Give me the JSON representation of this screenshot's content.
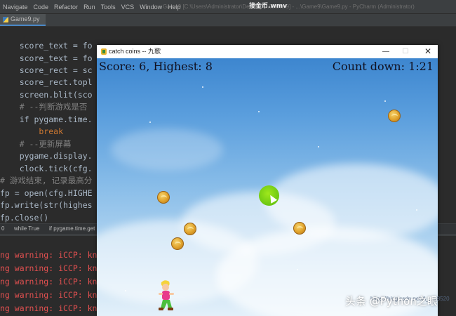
{
  "video_title": "接金币.wmv",
  "ide": {
    "menu": [
      "Navigate",
      "Code",
      "Refactor",
      "Run",
      "Tools",
      "VCS",
      "Window",
      "Help"
    ],
    "title": "Game9 [C:\\Users\\Administrator\\Desktop\\...\\Game9] - ...\\Game9\\Game9.py - PyCharm (Administrator)",
    "file_tab": "Game9.py",
    "code_lines": [
      {
        "code": "    score_text = fo"
      },
      {
        "code": "    score_text = fo"
      },
      {
        "code": "    score_rect = sc"
      },
      {
        "code": "    score_rect.topl"
      },
      {
        "code": "    screen.blit(sco"
      },
      {
        "code": "    # --判断游戏是否"
      },
      {
        "code": "    if pygame.time."
      },
      {
        "code": "        break"
      },
      {
        "code": "    # --更新屏幕"
      },
      {
        "code": "    pygame.display."
      },
      {
        "code": "    clock.tick(cfg."
      },
      {
        "code": "# 游戏结束, 记录最高分"
      },
      {
        "code": "fp = open(cfg.HIGHE"
      },
      {
        "code": "fp.write(str(highes"
      },
      {
        "code": "fp.close()"
      }
    ],
    "breadcrumb": [
      "0",
      "while True",
      "if pygame.time.get"
    ],
    "console_lines": [
      "ng warning: iCCP: kno",
      "ng warning: iCCP: kno",
      "ng warning: iCCP: kno",
      "ng warning: iCCP: kno",
      "ng warning: iCCP: kno"
    ]
  },
  "game_window": {
    "title": "catch coins -- 九歌",
    "minimize": "—",
    "maximize": "☐",
    "close": "✕",
    "score_text": "Score: 6, Highest: 8",
    "countdown_text": "Count down: 1:21"
  },
  "watermark": "头条 @Python之眼",
  "watermark_small": "https://blog.csdn.net/A_...78520",
  "icons": [
    "python-file-icon",
    "pygame-window-icon",
    "coin-icon",
    "player-sprite",
    "cursor-dot"
  ]
}
